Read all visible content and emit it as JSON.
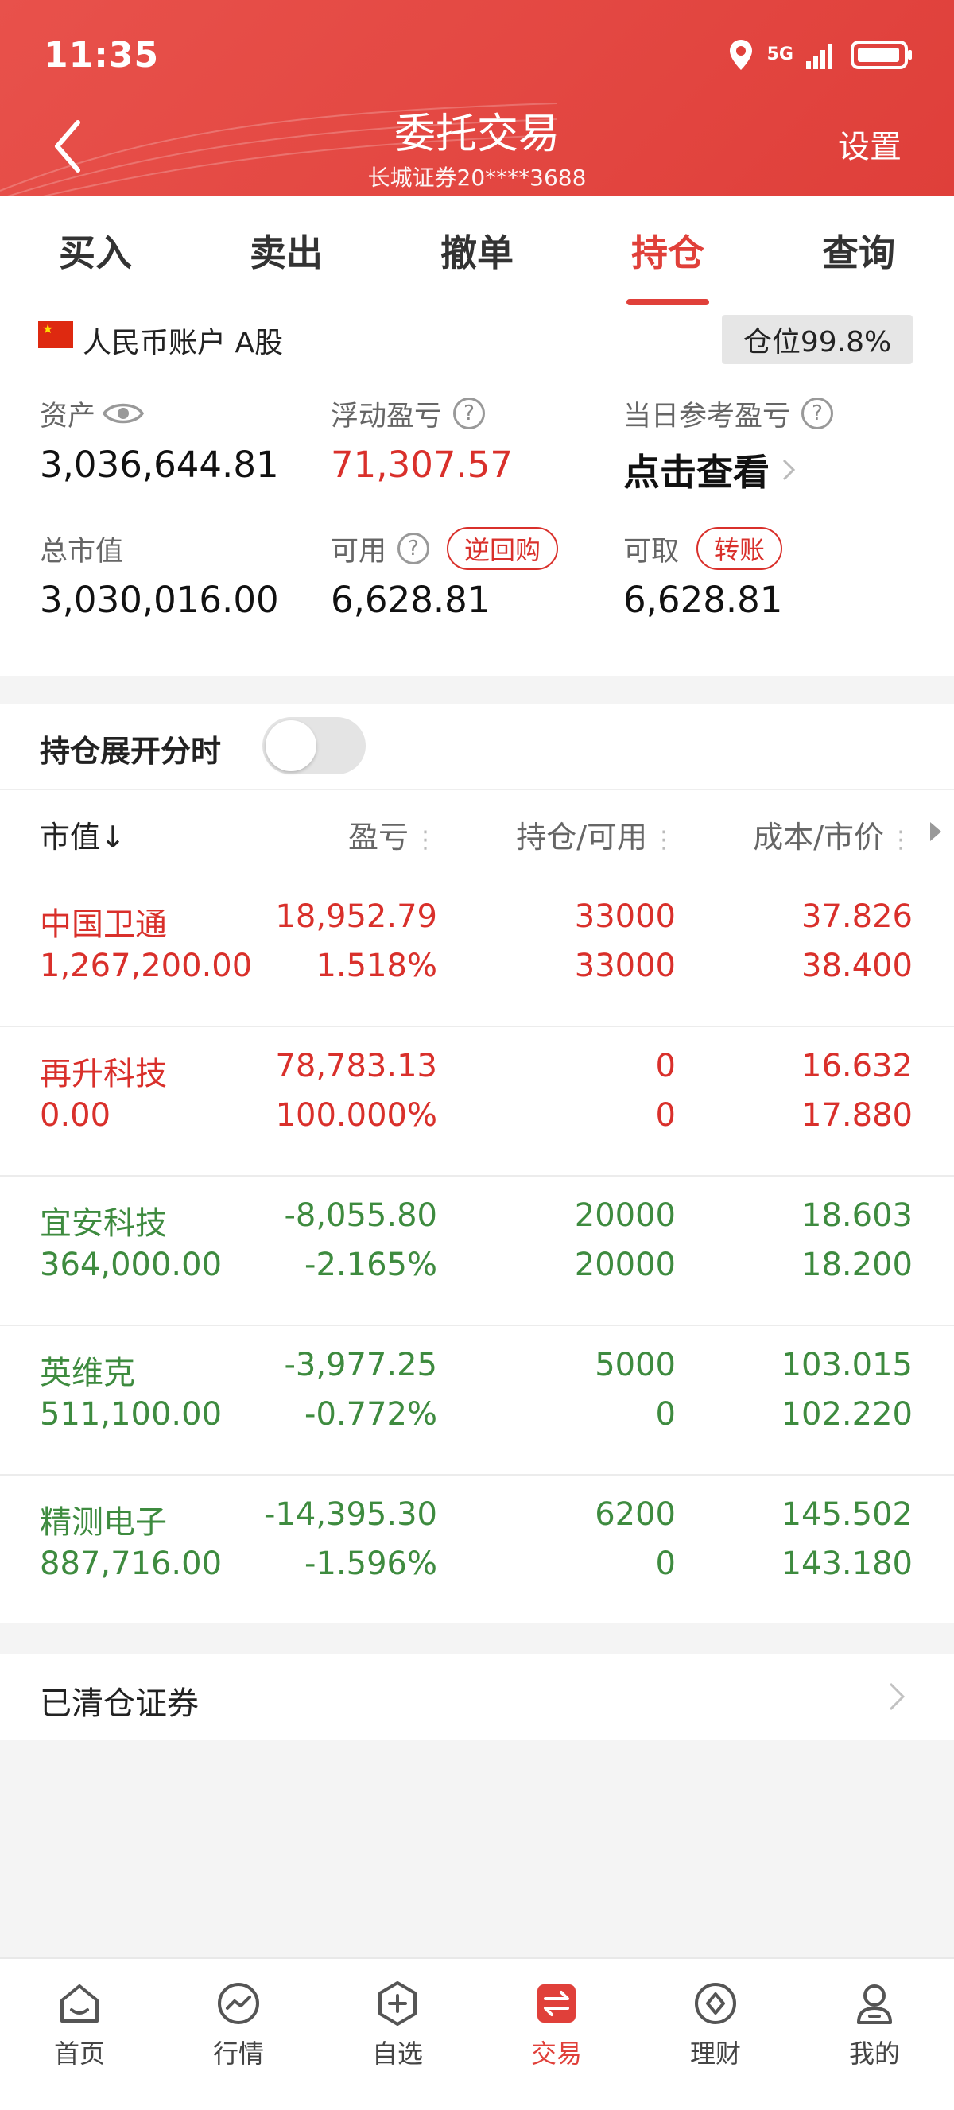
{
  "status": {
    "time": "11:35",
    "network": "5G"
  },
  "header": {
    "title": "委托交易",
    "subtitle": "长城证券20****3688",
    "settings": "设置"
  },
  "tabs": [
    {
      "label": "买入",
      "active": false
    },
    {
      "label": "卖出",
      "active": false
    },
    {
      "label": "撤单",
      "active": false
    },
    {
      "label": "持仓",
      "active": true
    },
    {
      "label": "查询",
      "active": false
    }
  ],
  "account": {
    "label": "人民币账户 A股",
    "position": "仓位99.8%"
  },
  "summary": {
    "assets_label": "资产",
    "assets": "3,036,644.81",
    "float_pl_label": "浮动盈亏",
    "float_pl": "71,307.57",
    "daily_pl_label": "当日参考盈亏",
    "daily_pl_action": "点击查看",
    "market_value_label": "总市值",
    "market_value": "3,030,016.00",
    "available_label": "可用",
    "available": "6,628.81",
    "reverse_repo": "逆回购",
    "withdrawable_label": "可取",
    "withdrawable": "6,628.81",
    "transfer": "转账"
  },
  "expand": {
    "label": "持仓展开分时",
    "on": false
  },
  "table": {
    "headers": {
      "market_value": "市值↓",
      "pl": "盈亏",
      "holding": "持仓/可用",
      "cost": "成本/市价"
    },
    "rows": [
      {
        "name": "中国卫通",
        "value": "1,267,200.00",
        "pl": "18,952.79",
        "pl_pct": "1.518%",
        "holding": "33000",
        "available": "33000",
        "cost": "37.826",
        "price": "38.400",
        "color": "#d9302b"
      },
      {
        "name": "再升科技",
        "value": "0.00",
        "pl": "78,783.13",
        "pl_pct": "100.000%",
        "holding": "0",
        "available": "0",
        "cost": "16.632",
        "price": "17.880",
        "color": "#d9302b"
      },
      {
        "name": "宜安科技",
        "value": "364,000.00",
        "pl": "-8,055.80",
        "pl_pct": "-2.165%",
        "holding": "20000",
        "available": "20000",
        "cost": "18.603",
        "price": "18.200",
        "color": "#3e8b3f"
      },
      {
        "name": "英维克",
        "value": "511,100.00",
        "pl": "-3,977.25",
        "pl_pct": "-0.772%",
        "holding": "5000",
        "available": "0",
        "cost": "103.015",
        "price": "102.220",
        "color": "#3e8b3f"
      },
      {
        "name": "精测电子",
        "value": "887,716.00",
        "pl": "-14,395.30",
        "pl_pct": "-1.596%",
        "holding": "6200",
        "available": "0",
        "cost": "145.502",
        "price": "143.180",
        "color": "#3e8b3f"
      }
    ]
  },
  "cleared": {
    "label": "已清仓证券"
  },
  "nav": [
    {
      "label": "首页",
      "icon": "home-icon",
      "active": false
    },
    {
      "label": "行情",
      "icon": "market-icon",
      "active": false
    },
    {
      "label": "自选",
      "icon": "watchlist-icon",
      "active": false
    },
    {
      "label": "交易",
      "icon": "trade-icon",
      "active": true
    },
    {
      "label": "理财",
      "icon": "finance-icon",
      "active": false
    },
    {
      "label": "我的",
      "icon": "profile-icon",
      "active": false
    }
  ],
  "colors": {
    "brand": "#e0403a",
    "up": "#d9302b",
    "down": "#3e8b3f"
  }
}
